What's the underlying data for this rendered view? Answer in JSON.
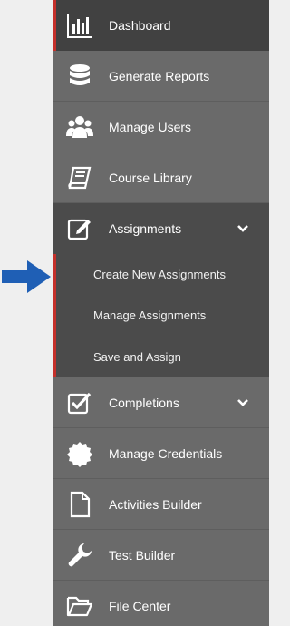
{
  "sidebar": {
    "items": [
      {
        "label": "Dashboard",
        "icon": "bar-chart-icon",
        "active": true
      },
      {
        "label": "Generate Reports",
        "icon": "database-icon"
      },
      {
        "label": "Manage Users",
        "icon": "users-icon"
      },
      {
        "label": "Course Library",
        "icon": "book-icon"
      },
      {
        "label": "Assignments",
        "icon": "edit-icon",
        "expanded": true,
        "children": [
          "Create New Assignments",
          "Manage Assignments",
          "Save and Assign"
        ]
      },
      {
        "label": "Completions",
        "icon": "checkbox-icon",
        "expanded": false
      },
      {
        "label": "Manage Credentials",
        "icon": "certificate-icon"
      },
      {
        "label": "Activities Builder",
        "icon": "file-icon"
      },
      {
        "label": "Test Builder",
        "icon": "wrench-icon"
      },
      {
        "label": "File Center",
        "icon": "folder-icon"
      }
    ]
  },
  "pointer": {
    "icon": "arrow-right-icon",
    "color": "#1f5fb5"
  },
  "colors": {
    "sidebar_bg": "#6a6a6a",
    "active_bg": "#414141",
    "submenu_bg": "#4b4b4b",
    "accent": "#c4302b"
  }
}
